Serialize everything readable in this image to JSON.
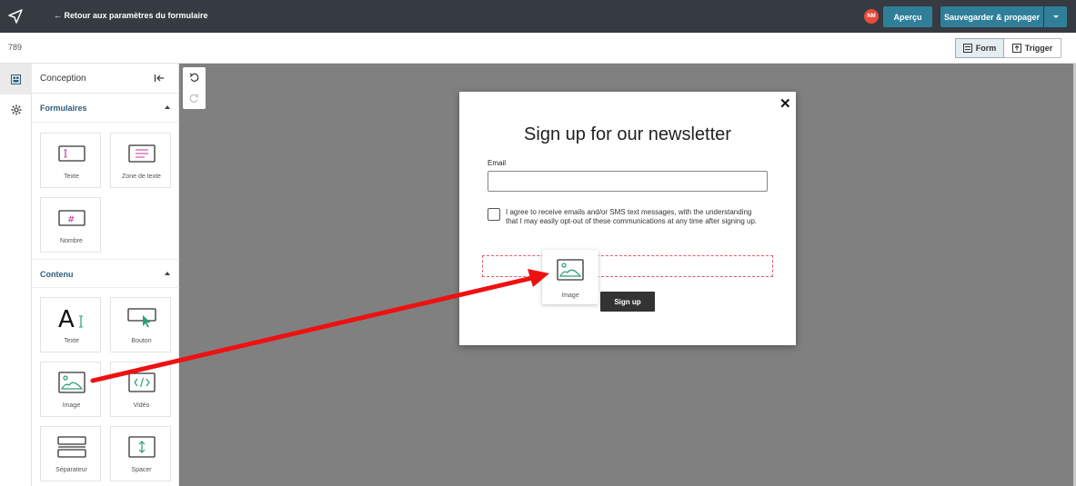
{
  "topbar": {
    "back_label": "← Retour aux paramètres du formulaire",
    "avatar_initials": "NM",
    "preview_label": "Aperçu",
    "save_label": "Sauvegarder & propager"
  },
  "subbar": {
    "form_id": "789",
    "tab_form": "Form",
    "tab_trigger": "Trigger"
  },
  "panel": {
    "title": "Conception",
    "sections": {
      "forms": {
        "title": "Formulaires",
        "items": [
          "Texte",
          "Zone de texte",
          "Nombre"
        ]
      },
      "content": {
        "title": "Contenu",
        "items": [
          "Texte",
          "Bouton",
          "Image",
          "Vidéo",
          "Séparateur",
          "Spacer"
        ]
      }
    }
  },
  "modal": {
    "title": "Sign up for our newsletter",
    "email_label": "Email",
    "email_value": "",
    "consent_text": "I agree to receive emails and/or SMS text messages, with the understanding that I may easily opt-out of these communications at any time after signing up.",
    "signup_label": "Sign up",
    "close_symbol": "✕"
  },
  "drag_ghost": {
    "label": "Image"
  },
  "colors": {
    "topbar_bg": "#363a41",
    "accent": "#2f7f99",
    "section_title": "#2d5d7b",
    "icon_pink": "#c0399a",
    "icon_green": "#2a9d72",
    "canvas_bg": "#808080",
    "annotation_arrow": "#ee1111"
  }
}
